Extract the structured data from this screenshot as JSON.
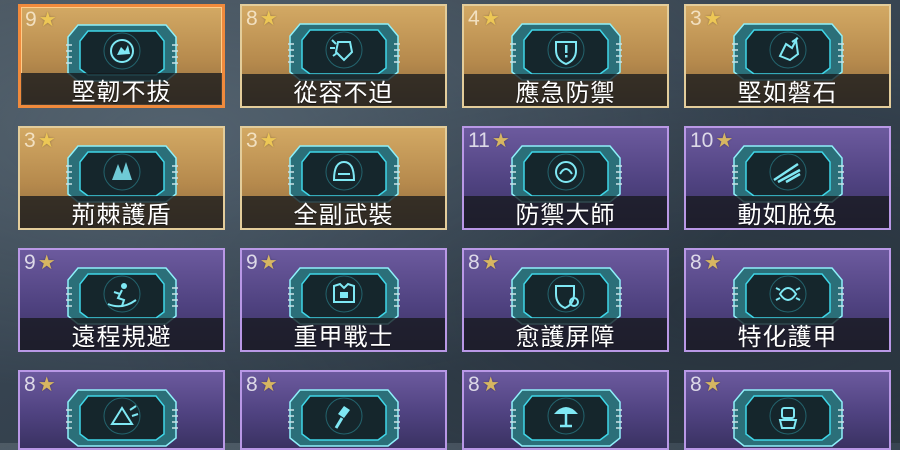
{
  "colors": {
    "gold_card": "#c49a58",
    "purple_card": "#5b4b8c",
    "gold_border": "#e3cd9b",
    "purple_border": "#b998e6",
    "selected_border": "#f08a3c",
    "star": "#f7d253",
    "chip_accent": "#3fd6e8"
  },
  "star_glyph": "★",
  "cards": [
    {
      "rank": "9",
      "name": "堅韌不拔",
      "rarity": "gold",
      "selected": true,
      "icon": "fist-emblem-icon"
    },
    {
      "rank": "8",
      "name": "從容不迫",
      "rarity": "gold",
      "selected": false,
      "icon": "shield-burst-icon"
    },
    {
      "rank": "4",
      "name": "應急防禦",
      "rarity": "gold",
      "selected": false,
      "icon": "shield-alert-icon"
    },
    {
      "rank": "3",
      "name": "堅如磐石",
      "rarity": "gold",
      "selected": false,
      "icon": "shattered-rock-icon"
    },
    {
      "rank": "3",
      "name": "荊棘護盾",
      "rarity": "gold",
      "selected": false,
      "icon": "thorn-shield-icon"
    },
    {
      "rank": "3",
      "name": "全副武裝",
      "rarity": "gold",
      "selected": false,
      "icon": "helmet-icon"
    },
    {
      "rank": "11",
      "name": "防禦大師",
      "rarity": "purple",
      "selected": false,
      "icon": "helmet-emblem-icon"
    },
    {
      "rank": "10",
      "name": "動如脫兔",
      "rarity": "purple",
      "selected": false,
      "icon": "speed-streak-icon"
    },
    {
      "rank": "9",
      "name": "遠程規避",
      "rarity": "purple",
      "selected": false,
      "icon": "dodge-figure-icon"
    },
    {
      "rank": "9",
      "name": "重甲戰士",
      "rarity": "purple",
      "selected": false,
      "icon": "heavy-armor-icon"
    },
    {
      "rank": "8",
      "name": "愈護屏障",
      "rarity": "purple",
      "selected": false,
      "icon": "heal-shield-icon"
    },
    {
      "rank": "8",
      "name": "特化護甲",
      "rarity": "purple",
      "selected": false,
      "icon": "shard-armor-icon"
    },
    {
      "rank": "8",
      "name": "",
      "rarity": "purple",
      "selected": false,
      "icon": "arrow-shield-icon"
    },
    {
      "rank": "8",
      "name": "",
      "rarity": "purple",
      "selected": false,
      "icon": "hammer-icon"
    },
    {
      "rank": "8",
      "name": "",
      "rarity": "purple",
      "selected": false,
      "icon": "mushroom-icon"
    },
    {
      "rank": "8",
      "name": "",
      "rarity": "purple",
      "selected": false,
      "icon": "robot-icon"
    }
  ]
}
